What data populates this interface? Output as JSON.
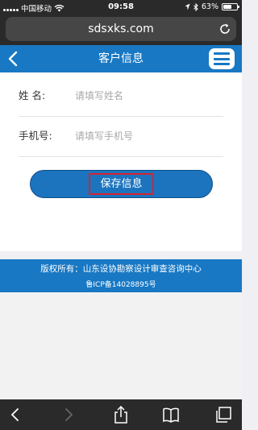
{
  "status_bar": {
    "carrier": "中国移动",
    "time": "09:58",
    "battery_text": "63%",
    "battery_level": 0.63
  },
  "browser": {
    "url": "sdsxks.com"
  },
  "header": {
    "title": "客户信息"
  },
  "form": {
    "name_label": "姓 名:",
    "name_placeholder": "请填写姓名",
    "phone_label": "手机号:",
    "phone_placeholder": "请填写手机号",
    "save_label": "保存信息"
  },
  "footer": {
    "copyright": "版权所有：山东设协勘察设计审查咨询中心",
    "icp": "鲁ICP备14028895号"
  },
  "colors": {
    "brand_blue": "#1878c4",
    "highlight_red": "#d9232e",
    "browser_chrome": "#2a2a2a"
  },
  "icons": {
    "status": [
      "signal-icon",
      "wifi-icon",
      "location-icon",
      "bluetooth-icon",
      "battery-icon"
    ],
    "browser": [
      "reload-icon"
    ],
    "header": [
      "back-arrow-icon",
      "menu-icon"
    ],
    "toolbar": [
      "back-icon",
      "forward-icon",
      "share-icon",
      "bookmarks-icon",
      "tabs-icon"
    ]
  }
}
